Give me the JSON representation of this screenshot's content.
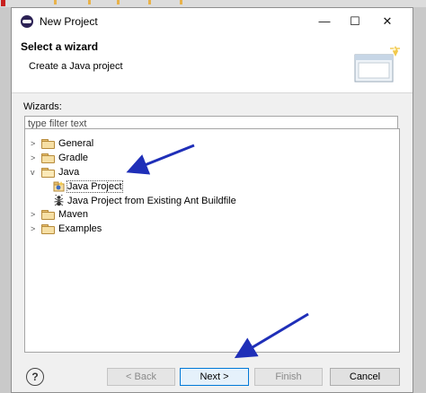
{
  "dialog": {
    "title": "New Project",
    "controls": {
      "minimize": "—",
      "maximize": "☐",
      "close": "✕"
    }
  },
  "header": {
    "title": "Select a wizard",
    "subtitle": "Create a Java project"
  },
  "wizards": {
    "label": "Wizards:",
    "filter_placeholder": "type filter text",
    "filter_value": "",
    "tree": [
      {
        "label": "General",
        "expanded": false,
        "icon": "folder-icon"
      },
      {
        "label": "Gradle",
        "expanded": false,
        "icon": "folder-icon"
      },
      {
        "label": "Java",
        "expanded": true,
        "icon": "folder-open-icon",
        "children": [
          {
            "label": "Java Project",
            "icon": "java-project-icon",
            "selected": true
          },
          {
            "label": "Java Project from Existing Ant Buildfile",
            "icon": "ant-icon"
          }
        ]
      },
      {
        "label": "Maven",
        "expanded": false,
        "icon": "folder-icon"
      },
      {
        "label": "Examples",
        "expanded": false,
        "icon": "folder-icon"
      }
    ]
  },
  "buttons": {
    "help": "?",
    "back": "< Back",
    "next": "Next >",
    "finish": "Finish",
    "cancel": "Cancel"
  },
  "colors": {
    "annotation_arrow": "#1f2fb8",
    "focus_border": "#0078d7"
  }
}
